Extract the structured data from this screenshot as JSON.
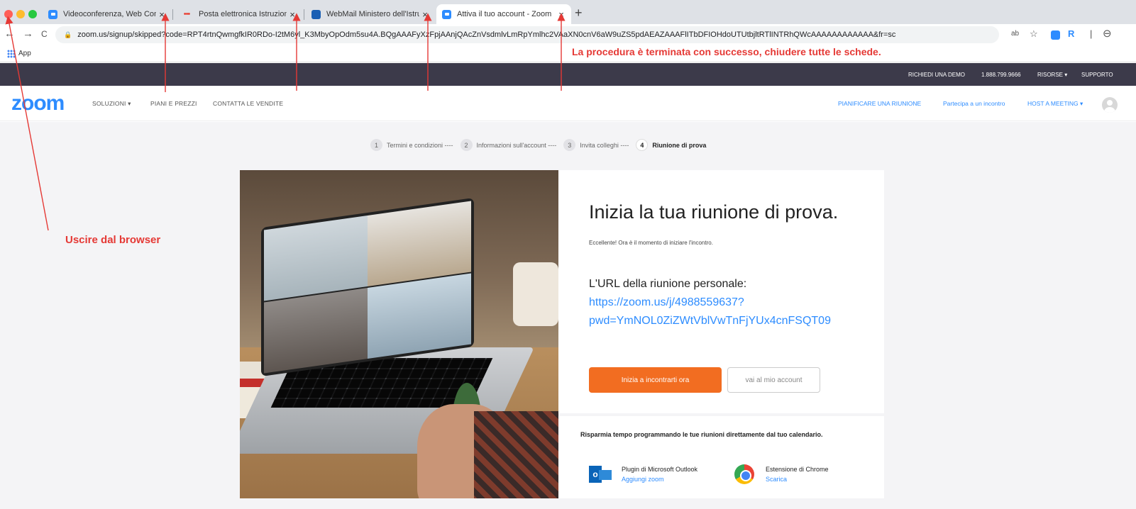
{
  "browser": {
    "tabs": [
      {
        "title": "Videoconferenza, Web Confere",
        "close": "×",
        "favicon": "zoom-icon"
      },
      {
        "title": "Posta elettronica Istruzione.it",
        "close": "×",
        "favicon": "dots-icon"
      },
      {
        "title": "WebMail Ministero dell'Istruzio",
        "close": "×",
        "favicon": "mail-icon"
      },
      {
        "title": "Attiva il tuo account - Zoom",
        "close": "×",
        "favicon": "zoom-icon",
        "active": true
      }
    ],
    "new_tab": "+",
    "url": "zoom.us/signup/skipped?code=RPT4rtnQwmgfkIR0RDo-I2tM6yl_K3MbyOpOdm5su4A.BQgAAAFyXzFpjAAnjQAcZnVsdmlvLmRpYmlhc2VAaXN0cnV6aW9uZS5pdAEAZAAAFlITbDFIOHdoUTUtbjltRTlINTRhQWcAAAAAAAAAAAA&fr=sc",
    "bookmarks_label": "App",
    "icons": {
      "back": "←",
      "forward": "→",
      "reload": "C",
      "star": "☆",
      "profile": "⊖",
      "translate": "ab",
      "ext_r": "R"
    }
  },
  "annotations": {
    "success_message": "La procedura è terminata con successo, chiudere tutte le schede.",
    "exit_browser": "Uscire dal browser",
    "color": "#e53935"
  },
  "zoom_topbar": {
    "request_demo": "RICHIEDI UNA DEMO",
    "phone": "1.888.799.9666",
    "resources": "RISORSE ▾",
    "support": "SUPPORTO"
  },
  "zoom_nav": {
    "logo": "zoom",
    "solutions": "SOLUZIONI ▾",
    "plans": "PIANI E PREZZI",
    "contact_sales": "CONTATTA LE VENDITE",
    "schedule": "PIANIFICARE UNA RIUNIONE",
    "join": "Partecipa a un incontro",
    "host": "HOST A MEETING ▾"
  },
  "steps": [
    {
      "num": "1",
      "label": "Termini e condizioni ----"
    },
    {
      "num": "2",
      "label": "Informazioni sull'account ----"
    },
    {
      "num": "3",
      "label": "Invita colleghi ----"
    },
    {
      "num": "4",
      "label": "Riunione di prova",
      "current": true
    }
  ],
  "card": {
    "title": "Inizia la tua riunione di prova.",
    "subtitle": "Eccellente! Ora è il momento di iniziare l'incontro.",
    "url_label": "L'URL della riunione personale:",
    "url_link": "https://zoom.us/j/4988559637?pwd=YmNOL0ZiZWtVblVwTnFjYUx4cnFSQT09",
    "start_button": "Inizia a incontrarti ora",
    "account_button": "vai al mio account",
    "calendar_text": "Risparmia tempo programmando le tue riunioni direttamente dal tuo calendario.",
    "outlook": {
      "name": "Plugin di Microsoft Outlook",
      "action": "Aggiungi zoom"
    },
    "chrome": {
      "name": "Estensione di Chrome",
      "action": "Scarica"
    }
  },
  "colors": {
    "zoom_blue": "#2d8cff",
    "orange": "#f26d21",
    "topbar": "#3c3a4a"
  }
}
